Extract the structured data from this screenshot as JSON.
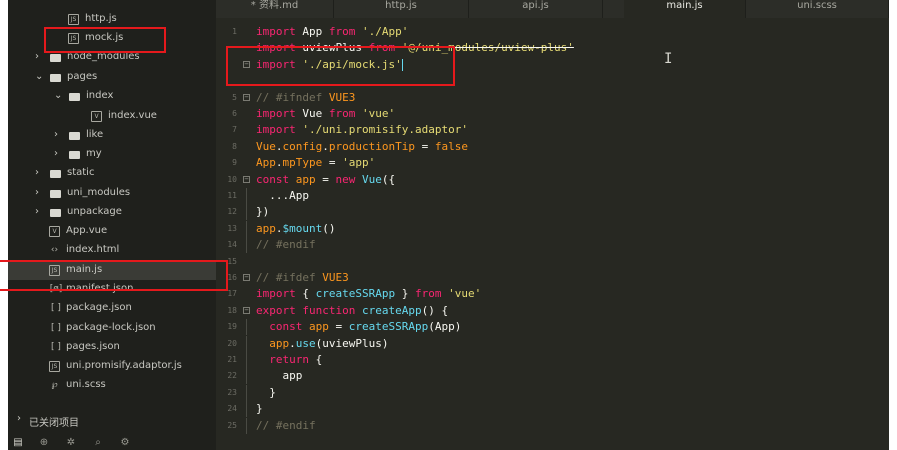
{
  "sidebar": {
    "items": [
      {
        "label": "http.js",
        "kind": "file",
        "icon": "js-file-icon",
        "indent": 2,
        "selected": false
      },
      {
        "label": "mock.js",
        "kind": "file",
        "icon": "js-file-icon",
        "indent": 2,
        "selected": false
      },
      {
        "label": "node_modules",
        "kind": "folder",
        "expanded": false,
        "indent": 0,
        "selected": false
      },
      {
        "label": "pages",
        "kind": "folder",
        "expanded": true,
        "indent": 0,
        "selected": false
      },
      {
        "label": "index",
        "kind": "folder",
        "expanded": true,
        "indent": 1,
        "selected": false
      },
      {
        "label": "index.vue",
        "kind": "file",
        "icon": "vue-file-icon",
        "indent": 3,
        "selected": false
      },
      {
        "label": "like",
        "kind": "folder",
        "expanded": false,
        "indent": 1,
        "selected": false
      },
      {
        "label": "my",
        "kind": "folder",
        "expanded": false,
        "indent": 1,
        "selected": false
      },
      {
        "label": "static",
        "kind": "folder",
        "expanded": false,
        "indent": 0,
        "selected": false
      },
      {
        "label": "uni_modules",
        "kind": "folder",
        "expanded": false,
        "indent": 0,
        "selected": false
      },
      {
        "label": "unpackage",
        "kind": "folder",
        "expanded": false,
        "indent": 0,
        "selected": false
      },
      {
        "label": "App.vue",
        "kind": "file",
        "icon": "vue-file-icon",
        "indent": 0,
        "selected": false
      },
      {
        "label": "index.html",
        "kind": "file",
        "icon": "html-file-icon",
        "indent": 0,
        "selected": false
      },
      {
        "label": "main.js",
        "kind": "file",
        "icon": "js-file-icon",
        "indent": 0,
        "selected": true
      },
      {
        "label": "manifest.json",
        "kind": "file",
        "icon": "manifest-file-icon",
        "indent": 0,
        "selected": false
      },
      {
        "label": "package.json",
        "kind": "file",
        "icon": "json-file-icon",
        "indent": 0,
        "selected": false
      },
      {
        "label": "package-lock.json",
        "kind": "file",
        "icon": "json-file-icon",
        "indent": 0,
        "selected": false
      },
      {
        "label": "pages.json",
        "kind": "file",
        "icon": "json-file-icon",
        "indent": 0,
        "selected": false
      },
      {
        "label": "uni.promisify.adaptor.js",
        "kind": "file",
        "icon": "js-file-icon",
        "indent": 0,
        "selected": false
      },
      {
        "label": "uni.scss",
        "kind": "file",
        "icon": "scss-file-icon",
        "indent": 0,
        "selected": false
      }
    ],
    "closed_projects_label": "已关闭项目",
    "bottom_icons": [
      "explorer-icon",
      "plugin-icon",
      "bug-icon",
      "search-icon",
      "settings-icon"
    ]
  },
  "tabs": [
    {
      "label": "* 资料.md",
      "active": false
    },
    {
      "label": "http.js",
      "active": false
    },
    {
      "label": "api.js",
      "active": false
    },
    {
      "label": "main.js",
      "active": true
    },
    {
      "label": "uni.scss",
      "active": false
    }
  ],
  "editor": {
    "lines": [
      {
        "n": "1",
        "fold": "",
        "tokens": [
          [
            "kw",
            "import"
          ],
          [
            "plain",
            " App "
          ],
          [
            "kw",
            "from"
          ],
          [
            "plain",
            " "
          ],
          [
            "str",
            "'./App'"
          ]
        ]
      },
      {
        "n": "",
        "fold": "",
        "strike": true,
        "tokens": [
          [
            "kw",
            "import"
          ],
          [
            "plain",
            " uviewPlus "
          ],
          [
            "kw",
            "from"
          ],
          [
            "plain",
            " "
          ],
          [
            "str",
            "'@/uni_modules/uview-plus'"
          ]
        ]
      },
      {
        "n": "",
        "fold": "box",
        "tokens": [
          [
            "kw",
            "import"
          ],
          [
            "plain",
            " "
          ],
          [
            "str",
            "'./api/mock.js'"
          ]
        ],
        "cursor": true
      },
      {
        "n": "",
        "fold": "",
        "tokens": []
      },
      {
        "n": "5",
        "fold": "box",
        "tokens": [
          [
            "cm",
            "// "
          ],
          [
            "cm",
            "#ifndef "
          ],
          [
            "id",
            "VUE3"
          ]
        ]
      },
      {
        "n": "6",
        "fold": "",
        "tokens": [
          [
            "kw",
            "import"
          ],
          [
            "plain",
            " Vue "
          ],
          [
            "kw",
            "from"
          ],
          [
            "plain",
            " "
          ],
          [
            "str",
            "'vue'"
          ]
        ]
      },
      {
        "n": "7",
        "fold": "",
        "tokens": [
          [
            "kw",
            "import"
          ],
          [
            "plain",
            " "
          ],
          [
            "str",
            "'./uni.promisify.adaptor'"
          ]
        ]
      },
      {
        "n": "8",
        "fold": "",
        "tokens": [
          [
            "id",
            "Vue"
          ],
          [
            "plain",
            "."
          ],
          [
            "id",
            "config"
          ],
          [
            "plain",
            "."
          ],
          [
            "id",
            "productionTip"
          ],
          [
            "plain",
            " = "
          ],
          [
            "id",
            "false"
          ]
        ]
      },
      {
        "n": "9",
        "fold": "",
        "tokens": [
          [
            "id",
            "App"
          ],
          [
            "plain",
            "."
          ],
          [
            "id",
            "mpType"
          ],
          [
            "plain",
            " = "
          ],
          [
            "str",
            "'app'"
          ]
        ]
      },
      {
        "n": "10",
        "fold": "box",
        "tokens": [
          [
            "kw",
            "const"
          ],
          [
            "plain",
            " "
          ],
          [
            "id",
            "app"
          ],
          [
            "plain",
            " = "
          ],
          [
            "kw",
            "new"
          ],
          [
            "plain",
            " "
          ],
          [
            "fn",
            "Vue"
          ],
          [
            "plain",
            "({"
          ]
        ]
      },
      {
        "n": "11",
        "fold": "guide",
        "tokens": [
          [
            "plain",
            "  ...App"
          ]
        ]
      },
      {
        "n": "12",
        "fold": "guide",
        "tokens": [
          [
            "plain",
            "})"
          ]
        ]
      },
      {
        "n": "13",
        "fold": "guide",
        "tokens": [
          [
            "id",
            "app"
          ],
          [
            "plain",
            "."
          ],
          [
            "fn",
            "$mount"
          ],
          [
            "plain",
            "()"
          ]
        ]
      },
      {
        "n": "14",
        "fold": "guide",
        "tokens": [
          [
            "cm",
            "// #endif"
          ]
        ]
      },
      {
        "n": "15",
        "fold": "",
        "tokens": []
      },
      {
        "n": "16",
        "fold": "box",
        "tokens": [
          [
            "cm",
            "// "
          ],
          [
            "cm",
            "#ifdef "
          ],
          [
            "id",
            "VUE3"
          ]
        ]
      },
      {
        "n": "17",
        "fold": "",
        "tokens": [
          [
            "kw",
            "import"
          ],
          [
            "plain",
            " { "
          ],
          [
            "fn",
            "createSSRApp"
          ],
          [
            "plain",
            " } "
          ],
          [
            "kw",
            "from"
          ],
          [
            "plain",
            " "
          ],
          [
            "str",
            "'vue'"
          ]
        ]
      },
      {
        "n": "18",
        "fold": "box",
        "tokens": [
          [
            "kw",
            "export"
          ],
          [
            "plain",
            " "
          ],
          [
            "kw",
            "function"
          ],
          [
            "plain",
            " "
          ],
          [
            "fn",
            "createApp"
          ],
          [
            "plain",
            "() {"
          ]
        ]
      },
      {
        "n": "19",
        "fold": "guide",
        "tokens": [
          [
            "plain",
            "  "
          ],
          [
            "kw",
            "const"
          ],
          [
            "plain",
            " "
          ],
          [
            "id",
            "app"
          ],
          [
            "plain",
            " = "
          ],
          [
            "fn",
            "createSSRApp"
          ],
          [
            "plain",
            "(App)"
          ]
        ]
      },
      {
        "n": "20",
        "fold": "guide",
        "tokens": [
          [
            "plain",
            "  "
          ],
          [
            "id",
            "app"
          ],
          [
            "plain",
            "."
          ],
          [
            "fn",
            "use"
          ],
          [
            "plain",
            "(uviewPlus)"
          ]
        ]
      },
      {
        "n": "21",
        "fold": "guide",
        "tokens": [
          [
            "plain",
            "  "
          ],
          [
            "kw",
            "return"
          ],
          [
            "plain",
            " {"
          ]
        ]
      },
      {
        "n": "22",
        "fold": "guide",
        "tokens": [
          [
            "plain",
            "    app"
          ]
        ]
      },
      {
        "n": "23",
        "fold": "guide",
        "tokens": [
          [
            "plain",
            "  }"
          ]
        ]
      },
      {
        "n": "24",
        "fold": "guide",
        "tokens": [
          [
            "plain",
            "}"
          ]
        ]
      },
      {
        "n": "25",
        "fold": "guide",
        "tokens": [
          [
            "cm",
            "// #endif"
          ]
        ]
      }
    ]
  },
  "colors": {
    "editor_bg": "#272822",
    "sidebar_bg": "#1f201c",
    "keyword": "#f92672",
    "string": "#e6db74",
    "function": "#66d9ef",
    "comment": "#75715e",
    "identifier": "#fd971f",
    "annotation_red": "#e5191c"
  }
}
